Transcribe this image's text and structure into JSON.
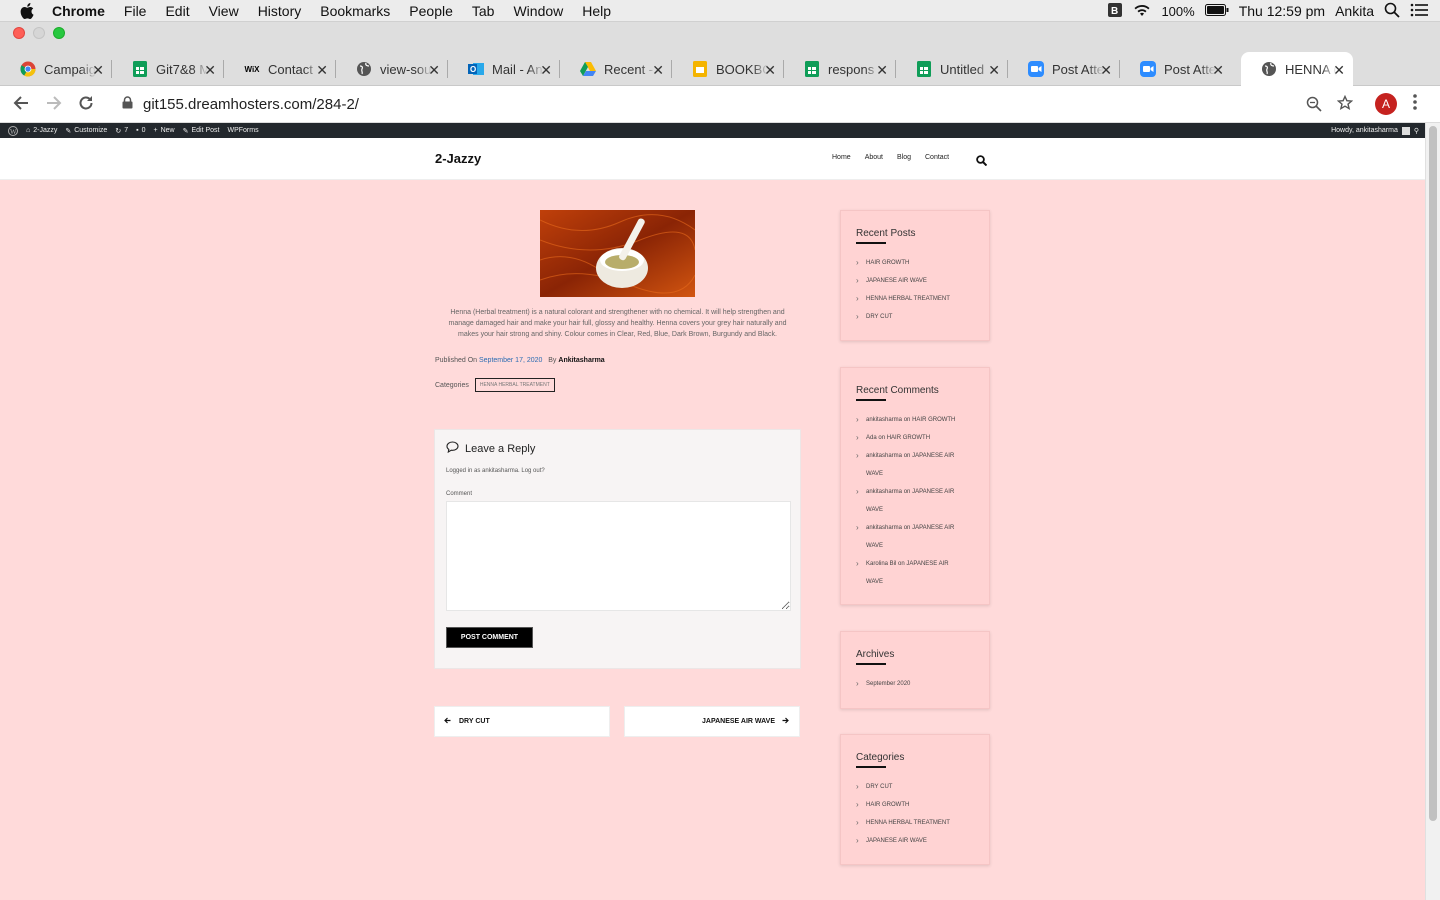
{
  "menubar": {
    "app": "Chrome",
    "items": [
      "File",
      "Edit",
      "View",
      "History",
      "Bookmarks",
      "People",
      "Tab",
      "Window",
      "Help"
    ],
    "battery": "100%",
    "clock": "Thu 12:59 pm",
    "user": "Ankita"
  },
  "tabs": [
    {
      "label": "Campaig",
      "icon": "chrome-icon"
    },
    {
      "label": "Git7&8 M",
      "icon": "sheets-icon"
    },
    {
      "label": "Contact",
      "icon": "wix-icon"
    },
    {
      "label": "view-sou",
      "icon": "globe-icon"
    },
    {
      "label": "Mail - An",
      "icon": "outlook-icon"
    },
    {
      "label": "Recent -",
      "icon": "drive-icon"
    },
    {
      "label": "BOOKBC",
      "icon": "slides-icon"
    },
    {
      "label": "respons",
      "icon": "sheets-icon"
    },
    {
      "label": "Untitled",
      "icon": "sheets-icon"
    },
    {
      "label": "Post Atte",
      "icon": "zoom-icon"
    },
    {
      "label": "Post Atte",
      "icon": "zoom-icon"
    },
    {
      "label": "HENNA (",
      "icon": "globe-icon",
      "active": true
    }
  ],
  "toolbar": {
    "url": "git155.dreamhosters.com/284-2/",
    "avatar_letter": "A"
  },
  "wpbar": {
    "items": [
      "2-Jazzy",
      "Customize",
      "7",
      "0",
      "New",
      "Edit Post",
      "WPForms"
    ],
    "howdy": "Howdy, ankitasharma"
  },
  "site": {
    "title": "2-Jazzy",
    "nav": [
      "Home",
      "About",
      "Blog",
      "Contact"
    ]
  },
  "post": {
    "excerpt": "Henna (Herbal treatment) is a natural colorant and strengthener with no chemical. It will help strengthen and manage damaged hair and make your hair full, glossy and healthy. Henna covers your grey hair naturally and makes your hair strong and shiny. Colour comes in Clear, Red, Blue, Dark Brown, Burgundy and Black.",
    "published_label": "Published On",
    "date": "September 17, 2020",
    "by_label": "By",
    "author": "Ankitasharma",
    "categories_label": "Categories",
    "category": "HENNA HERBAL TREATMENT"
  },
  "reply": {
    "title": "Leave a Reply",
    "logged_in": "Logged in as ankitasharma. Log out?",
    "comment_label": "Comment",
    "submit": "POST COMMENT"
  },
  "postnav": {
    "prev": "DRY CUT",
    "next": "JAPANESE AIR WAVE"
  },
  "sidebar": {
    "recent_posts": {
      "title": "Recent Posts",
      "items": [
        "HAIR GROWTH",
        "JAPANESE AIR WAVE",
        "HENNA HERBAL TREATMENT",
        "DRY CUT"
      ]
    },
    "recent_comments": {
      "title": "Recent Comments",
      "items": [
        {
          "author": "ankitasharma",
          "on": "on",
          "post": "HAIR GROWTH"
        },
        {
          "author": "Ada",
          "on": "on",
          "post": "HAIR GROWTH"
        },
        {
          "author": "ankitasharma",
          "on": "on",
          "post": "JAPANESE AIR WAVE"
        },
        {
          "author": "ankitasharma",
          "on": "on",
          "post": "JAPANESE AIR WAVE"
        },
        {
          "author": "ankitasharma",
          "on": "on",
          "post": "JAPANESE AIR WAVE"
        },
        {
          "author": "Karolina Bil",
          "on": "on",
          "post": "JAPANESE AIR WAVE"
        }
      ]
    },
    "archives": {
      "title": "Archives",
      "items": [
        "September 2020"
      ]
    },
    "categories": {
      "title": "Categories",
      "items": [
        "DRY CUT",
        "HAIR GROWTH",
        "HENNA HERBAL TREATMENT",
        "JAPANESE AIR WAVE"
      ]
    }
  },
  "colors": {
    "page_bg": "#ffdada",
    "link": "#2d6db3",
    "admin_bar": "#23282d"
  }
}
